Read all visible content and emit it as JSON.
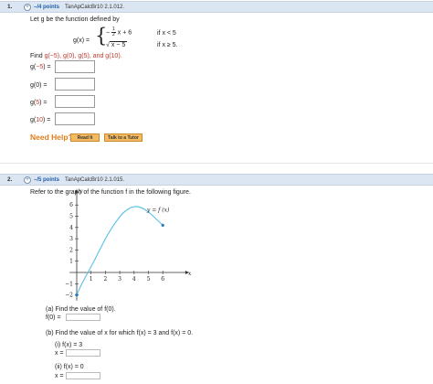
{
  "q1": {
    "number": "1.",
    "points": "–/4 points",
    "source": "TanApCalcBr10 2.1.012.",
    "intro": "Let g be the function defined by",
    "gx_label": "g(x) =",
    "piece1_pre": "−",
    "piece1_frac_num": "1",
    "piece1_frac_den": "2",
    "piece1_post": "x + 6",
    "piece1_cond": "if x < 5",
    "piece2_rad": "√",
    "piece2_expr": "x − 5",
    "piece2_cond": "if x ≥ 5.",
    "find_prefix": "Find",
    "find_vals": "g(−5), g(0), g(5), and g(10).",
    "fields": [
      {
        "pre": "g(",
        "arg": "−5",
        "post": ") ="
      },
      {
        "pre": "g(0) =",
        "arg": "",
        "post": ""
      },
      {
        "pre": "g(",
        "arg": "5",
        "post": ") ="
      },
      {
        "pre": "g(",
        "arg": "10",
        "post": ") ="
      }
    ],
    "need_help": "Need Help?",
    "read_it": "Read It",
    "talk_tutor": "Talk to a Tutor"
  },
  "q2": {
    "number": "2.",
    "points": "–/5 points",
    "source": "TanApCalcBr10 2.1.015.",
    "intro": "Refer to the graph of the function f in the following figure.",
    "part_a": "(a) Find the value of f(0).",
    "f0": "f(0) =",
    "part_b": "(b) Find the value of x for which f(x) = 3 and f(x) = 0.",
    "b_i": "(i)    f(x) = 3",
    "b_ii": "(ii)   f(x) = 0",
    "x_eq": "x ="
  },
  "chart_data": {
    "type": "line",
    "title": "",
    "xlabel": "x",
    "ylabel": "y",
    "curve_label": "y = f (x)",
    "xlim": [
      -0.5,
      7
    ],
    "ylim": [
      -2.5,
      7
    ],
    "x_ticks": [
      "1",
      "2",
      "3",
      "4",
      "5",
      "6"
    ],
    "y_ticks": [
      "6",
      "5",
      "4",
      "3",
      "2",
      "1",
      "−1",
      "−2"
    ],
    "series": [
      {
        "values": [
          [
            0,
            -2
          ],
          [
            0.2,
            -1.4
          ],
          [
            0.6,
            -0.4
          ],
          [
            1,
            0.5
          ],
          [
            1.6,
            2
          ],
          [
            2.2,
            3.5
          ],
          [
            3,
            5
          ],
          [
            3.5,
            5.6
          ],
          [
            4,
            5.9
          ],
          [
            4.5,
            5.8
          ],
          [
            5,
            5.4
          ],
          [
            5.5,
            4.8
          ],
          [
            6,
            4.2
          ]
        ]
      }
    ],
    "endpoints": [
      [
        0,
        -2
      ],
      [
        6,
        4.2
      ]
    ],
    "colors": {
      "curve": "#58c0e8",
      "axis": "#333333"
    }
  }
}
